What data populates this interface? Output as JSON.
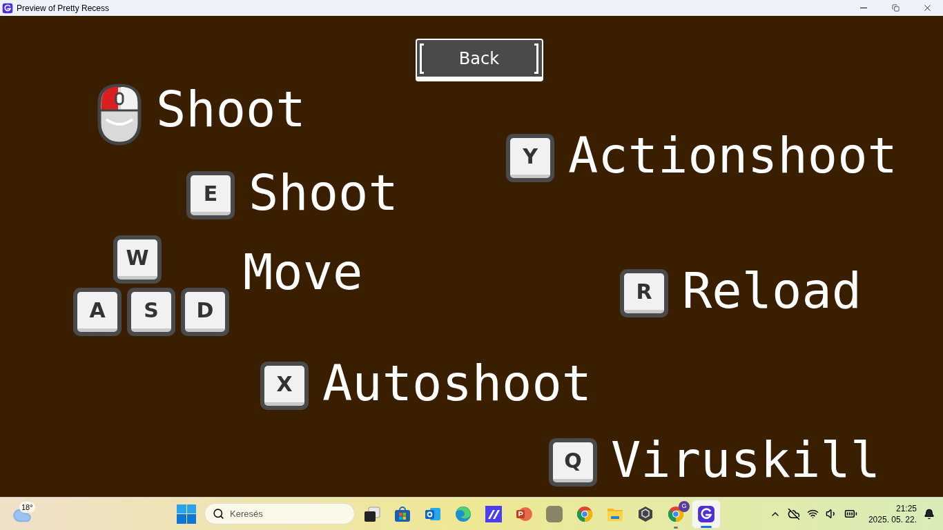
{
  "window": {
    "title": "Preview of Pretty Recess"
  },
  "back_button": {
    "label": "Back"
  },
  "bindings": [
    {
      "kind": "mouse",
      "label": "Shoot"
    },
    {
      "kind": "keys",
      "keys": [
        "E"
      ],
      "label": "Shoot"
    },
    {
      "kind": "keys",
      "keys": [
        "Y"
      ],
      "label": "Actionshoot"
    },
    {
      "kind": "wasd",
      "keys": [
        "W",
        "A",
        "S",
        "D"
      ],
      "label": "Move"
    },
    {
      "kind": "keys",
      "keys": [
        "R"
      ],
      "label": "Reload"
    },
    {
      "kind": "keys",
      "keys": [
        "X"
      ],
      "label": "Autoshoot"
    },
    {
      "kind": "keys",
      "keys": [
        "Q"
      ],
      "label": "Viruskill"
    }
  ],
  "taskbar": {
    "weather": "18°",
    "search": {
      "placeholder": "Keresés"
    },
    "apps": [
      {
        "kind": "taskview",
        "selected": false,
        "running": false
      },
      {
        "kind": "store",
        "selected": false,
        "running": false
      },
      {
        "kind": "outlook",
        "selected": false,
        "running": false
      },
      {
        "kind": "edge",
        "selected": false,
        "running": false
      },
      {
        "kind": "editor",
        "selected": false,
        "running": false
      },
      {
        "kind": "powerpoint",
        "selected": false,
        "running": false
      },
      {
        "kind": "blank",
        "selected": false,
        "running": false
      },
      {
        "kind": "chrome",
        "selected": false,
        "running": false
      },
      {
        "kind": "folder",
        "selected": false,
        "running": false
      },
      {
        "kind": "unity",
        "selected": false,
        "running": false
      },
      {
        "kind": "chrome",
        "selected": false,
        "running": true,
        "badge": "G"
      },
      {
        "kind": "game",
        "selected": true,
        "running": true
      }
    ],
    "time": "21:25",
    "date": "2025. 05. 22."
  }
}
